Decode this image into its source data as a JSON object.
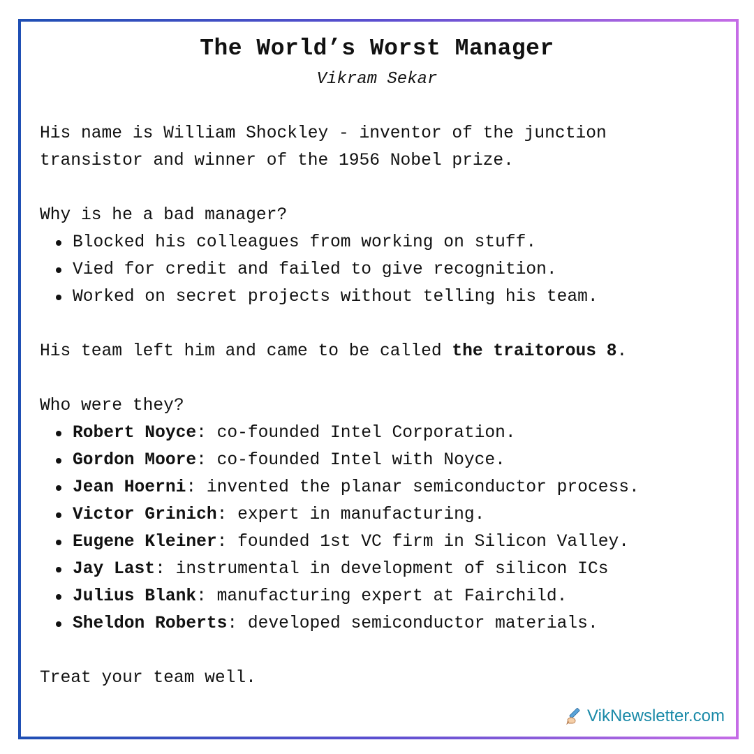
{
  "title": "The World’s Worst Manager",
  "author": "Vikram Sekar",
  "intro": {
    "line1": "His name is William Shockley - inventor of the junction",
    "line2": "transistor and winner of the 1956 Nobel prize."
  },
  "why": {
    "question": "Why is he a bad manager?",
    "items": [
      "Blocked his colleagues from working on stuff.",
      "Vied for credit and failed to give recognition.",
      "Worked on secret projects without telling his team."
    ]
  },
  "team": {
    "prefix": "His team left him and came to be called ",
    "bold": "the traitorous 8",
    "suffix": "."
  },
  "who": {
    "question": "Who were they?",
    "members": [
      {
        "name": "Robert Noyce",
        "desc": ": co-founded Intel Corporation."
      },
      {
        "name": "Gordon Moore",
        "desc": ": co-founded Intel with Noyce."
      },
      {
        "name": "Jean Hoerni",
        "desc": ": invented the planar semiconductor process."
      },
      {
        "name": "Victor Grinich",
        "desc": ": expert in manufacturing."
      },
      {
        "name": "Eugene Kleiner",
        "desc": ": founded 1st VC firm in Silicon Valley."
      },
      {
        "name": "Jay Last",
        "desc": ": instrumental in development of silicon ICs"
      },
      {
        "name": "Julius Blank",
        "desc": ": manufacturing expert at Fairchild."
      },
      {
        "name": "Sheldon Roberts",
        "desc": ": developed semiconductor materials."
      }
    ]
  },
  "closing": "Treat your team well.",
  "footer": {
    "icon": "writing-hand-icon",
    "site": "VikNewsletter.com"
  },
  "colors": {
    "frame_start": "#1f4fb4",
    "frame_end": "#c56ce6",
    "footer_text": "#1a8aa8"
  }
}
